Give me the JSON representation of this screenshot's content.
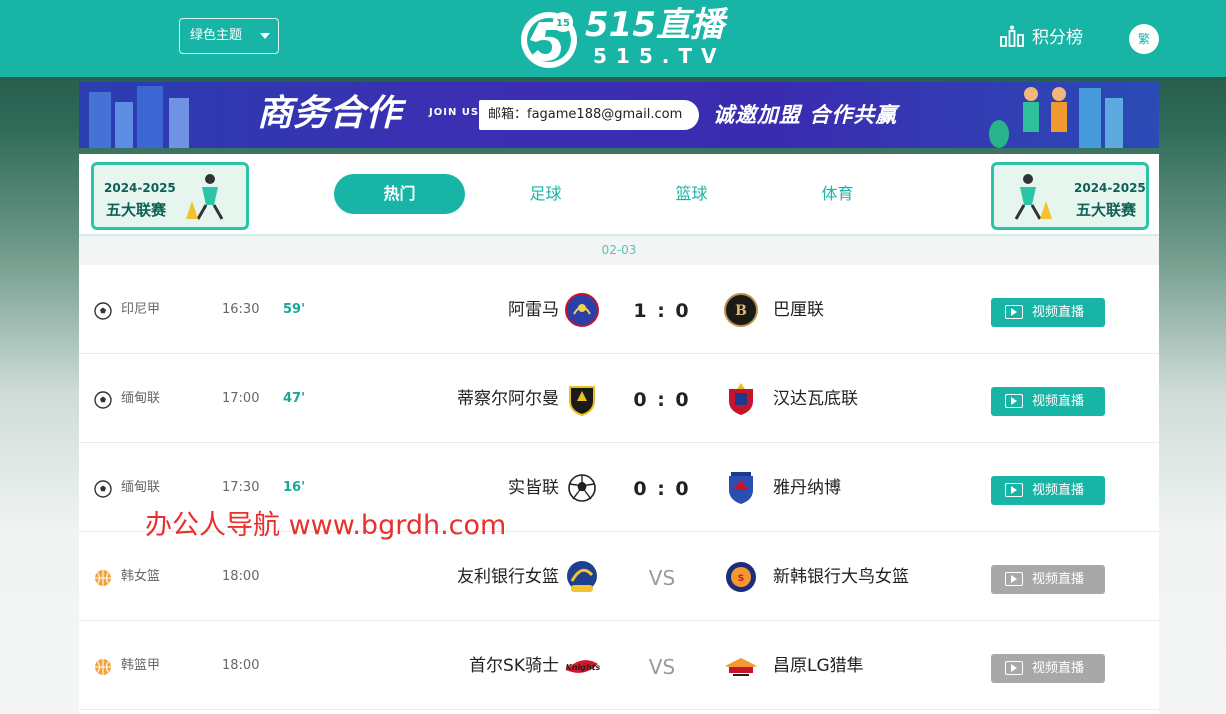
{
  "header": {
    "theme_select": "绿色主题",
    "logo_title": "515直播",
    "logo_sub": "515.TV",
    "rank_label": "积分榜",
    "trad_label": "繁"
  },
  "banner": {
    "title": "商务合作",
    "join": "JOIN US",
    "email": "邮箱：fagame188@gmail.com",
    "slogan": "诚邀加盟 合作共赢"
  },
  "league_badge": {
    "year": "2024-2025",
    "name": "五大联赛"
  },
  "tabs": [
    {
      "label": "热门",
      "active": true
    },
    {
      "label": "足球",
      "active": false
    },
    {
      "label": "篮球",
      "active": false
    },
    {
      "label": "体育",
      "active": false
    }
  ],
  "date": "02-03",
  "matches": [
    {
      "sport": "football",
      "league": "印尼甲",
      "time": "16:30",
      "minute": "59'",
      "home": "阿雷马",
      "score": "1 : 0",
      "away": "巴厘联",
      "button": "视频直播",
      "live": true
    },
    {
      "sport": "football",
      "league": "缅甸联",
      "time": "17:00",
      "minute": "47'",
      "home": "蒂察尔阿尔曼",
      "score": "0 : 0",
      "away": "汉达瓦底联",
      "button": "视频直播",
      "live": true
    },
    {
      "sport": "football",
      "league": "缅甸联",
      "time": "17:30",
      "minute": "16'",
      "home": "实皆联",
      "score": "0 : 0",
      "away": "雅丹纳博",
      "button": "视频直播",
      "live": true
    },
    {
      "sport": "basketball",
      "league": "韩女篮",
      "time": "18:00",
      "minute": "",
      "home": "友利银行女篮",
      "score": "VS",
      "away": "新韩银行大鸟女篮",
      "button": "视频直播",
      "live": false
    },
    {
      "sport": "basketball",
      "league": "韩篮甲",
      "time": "18:00",
      "minute": "",
      "home": "首尔SK骑士",
      "score": "VS",
      "away": "昌原LG猎隼",
      "button": "视频直播",
      "live": false
    }
  ],
  "watermark": "办公人导航  www.bgrdh.com",
  "colors": {
    "accent": "#18b4a6",
    "disabled": "#a8a8a8",
    "watermark": "#e8302c"
  }
}
